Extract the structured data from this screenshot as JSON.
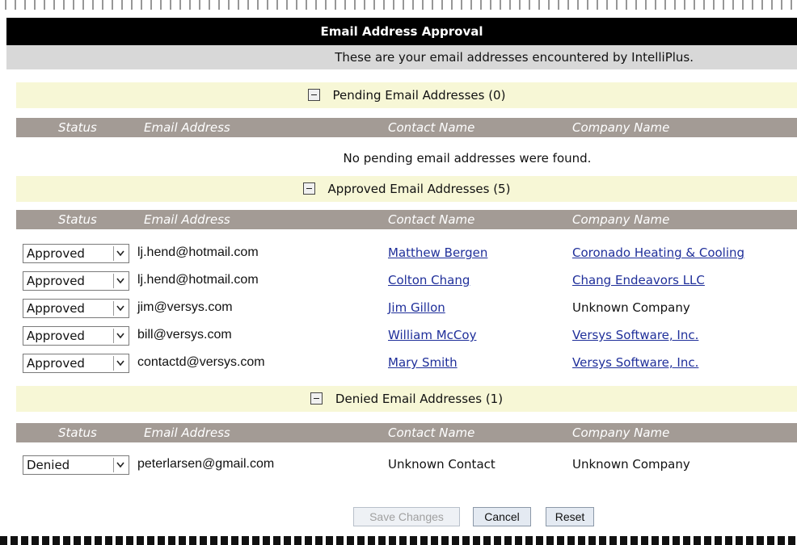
{
  "title": "Email Address Approval",
  "subtitle": "These are your email addresses encountered by IntelliPlus.",
  "columns": {
    "status": "Status",
    "email": "Email Address",
    "contact": "Contact Name",
    "company": "Company Name"
  },
  "pending": {
    "heading": "Pending Email Addresses (0)",
    "empty_message": "No pending email addresses were found."
  },
  "approved": {
    "heading": "Approved Email Addresses (5)",
    "rows": [
      {
        "status": "Approved",
        "email": "lj.hend@hotmail.com",
        "contact": "Matthew Bergen",
        "company": "Coronado Heating & Cooling"
      },
      {
        "status": "Approved",
        "email": "lj.hend@hotmail.com",
        "contact": "Colton Chang",
        "company": "Chang Endeavors LLC"
      },
      {
        "status": "Approved",
        "email": "jim@versys.com",
        "contact": "Jim Gillon",
        "company": "Unknown Company"
      },
      {
        "status": "Approved",
        "email": "bill@versys.com",
        "contact": "William McCoy",
        "company": "Versys Software, Inc."
      },
      {
        "status": "Approved",
        "email": "contactd@versys.com",
        "contact": "Mary Smith",
        "company": "Versys Software, Inc."
      }
    ]
  },
  "denied": {
    "heading": "Denied Email Addresses (1)",
    "rows": [
      {
        "status": "Denied",
        "email": "peterlarsen@gmail.com",
        "contact": "Unknown Contact",
        "company": "Unknown Company"
      }
    ]
  },
  "buttons": {
    "save": "Save Changes",
    "cancel": "Cancel",
    "reset": "Reset"
  },
  "colors": {
    "title_bg": "#000000",
    "subtitle_bg": "#d8d8d8",
    "section_bg": "#f7f7d6",
    "header_bg": "#a39b95",
    "link": "#1f2f9a"
  }
}
